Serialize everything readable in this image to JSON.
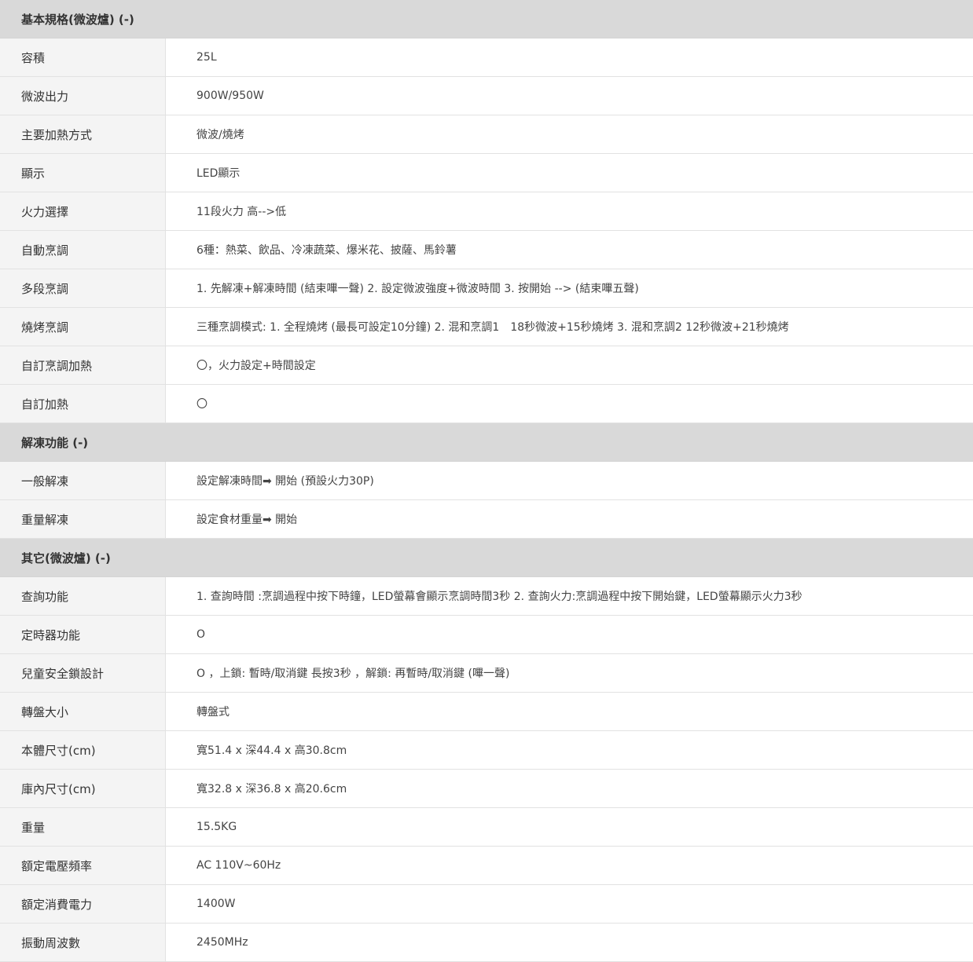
{
  "sections": [
    {
      "title": "基本規格(微波爐) (-)",
      "rows": [
        {
          "label": "容積",
          "value": "25L"
        },
        {
          "label": "微波出力",
          "value": "900W/950W"
        },
        {
          "label": "主要加熱方式",
          "value": "微波/燒烤"
        },
        {
          "label": "顯示",
          "value": "LED顯示"
        },
        {
          "label": "火力選擇",
          "value": "11段火力 高-->低"
        },
        {
          "label": "自動烹調",
          "value": "6種：熱菜、飲品、冷凍蔬菜、爆米花、披薩、馬鈴薯"
        },
        {
          "label": "多段烹調",
          "value": "1. 先解凍+解凍時間 (結束嗶一聲) 2. 設定微波強度+微波時間 3. 按開始 --> (結束嗶五聲)"
        },
        {
          "label": "燒烤烹調",
          "value": "三種烹調模式: 1. 全程燒烤 (最長可設定10分鐘) 2. 混和烹調1　18秒微波+15秒燒烤 3. 混和烹調2 12秒微波+21秒燒烤"
        },
        {
          "label": "自訂烹調加熱",
          "value": "〇，火力設定+時間設定"
        },
        {
          "label": "自訂加熱",
          "value": "〇"
        }
      ]
    },
    {
      "title": "解凍功能 (-)",
      "rows": [
        {
          "label": "一般解凍",
          "value": "設定解凍時間➡ 開始 (預設火力30P)"
        },
        {
          "label": "重量解凍",
          "value": "設定食材重量➡ 開始"
        }
      ]
    },
    {
      "title": "其它(微波爐) (-)",
      "rows": [
        {
          "label": "查詢功能",
          "value": "1. 查詢時間 :烹調過程中按下時鐘，LED螢幕會顯示烹調時間3秒 2. 查詢火力:烹調過程中按下開始鍵，LED螢幕顯示火力3秒"
        },
        {
          "label": "定時器功能",
          "value": "O"
        },
        {
          "label": "兒童安全鎖設計",
          "value": "O ，上鎖: 暫時/取消鍵 長按3秒 ，解鎖: 再暫時/取消鍵 (嗶一聲)"
        },
        {
          "label": "轉盤大小",
          "value": "轉盤式"
        },
        {
          "label": "本體尺寸(cm)",
          "value": "寬51.4 x 深44.4 x 高30.8cm"
        },
        {
          "label": "庫內尺寸(cm)",
          "value": "寬32.8 x 深36.8 x 高20.6cm"
        },
        {
          "label": "重量",
          "value": "15.5KG"
        },
        {
          "label": "額定電壓頻率",
          "value": "AC 110V~60Hz"
        },
        {
          "label": "額定消費電力",
          "value": "1400W"
        },
        {
          "label": "振動周波數",
          "value": "2450MHz"
        }
      ]
    }
  ],
  "colors": {
    "section_header_bg": "#d9d9d9",
    "label_bg": "#f4f4f4",
    "value_bg": "#ffffff",
    "border": "#e2e2e2",
    "text": "#333333"
  }
}
